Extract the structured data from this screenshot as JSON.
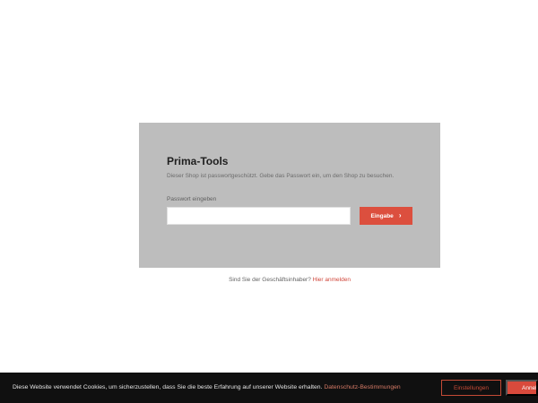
{
  "login": {
    "title": "Prima-Tools",
    "description": "Dieser Shop ist passwortgeschützt. Gebe das Passwort ein, um den Shop zu besuchen.",
    "password_label": "Passwort eingeben",
    "password_value": "",
    "password_placeholder": "",
    "submit_label": "Eingabe",
    "submit_icon": "chevron-right-icon",
    "submit_arrow": "›"
  },
  "owner": {
    "question": "Sind Sie der Geschäftsinhaber?",
    "link_label": "Hier anmelden"
  },
  "cookie_bar": {
    "text": "Diese Website verwendet Cookies, um sicherzustellen, dass Sie die beste Erfahrung auf unserer Website erhalten.",
    "privacy_link": "Datenschutz-Bestimmungen",
    "settings_label": "Einstellungen",
    "accept_label": "Annehmen"
  },
  "colors": {
    "accent": "#dc4f3e",
    "card_background": "#bdbdbd",
    "cookie_background": "#101010"
  }
}
